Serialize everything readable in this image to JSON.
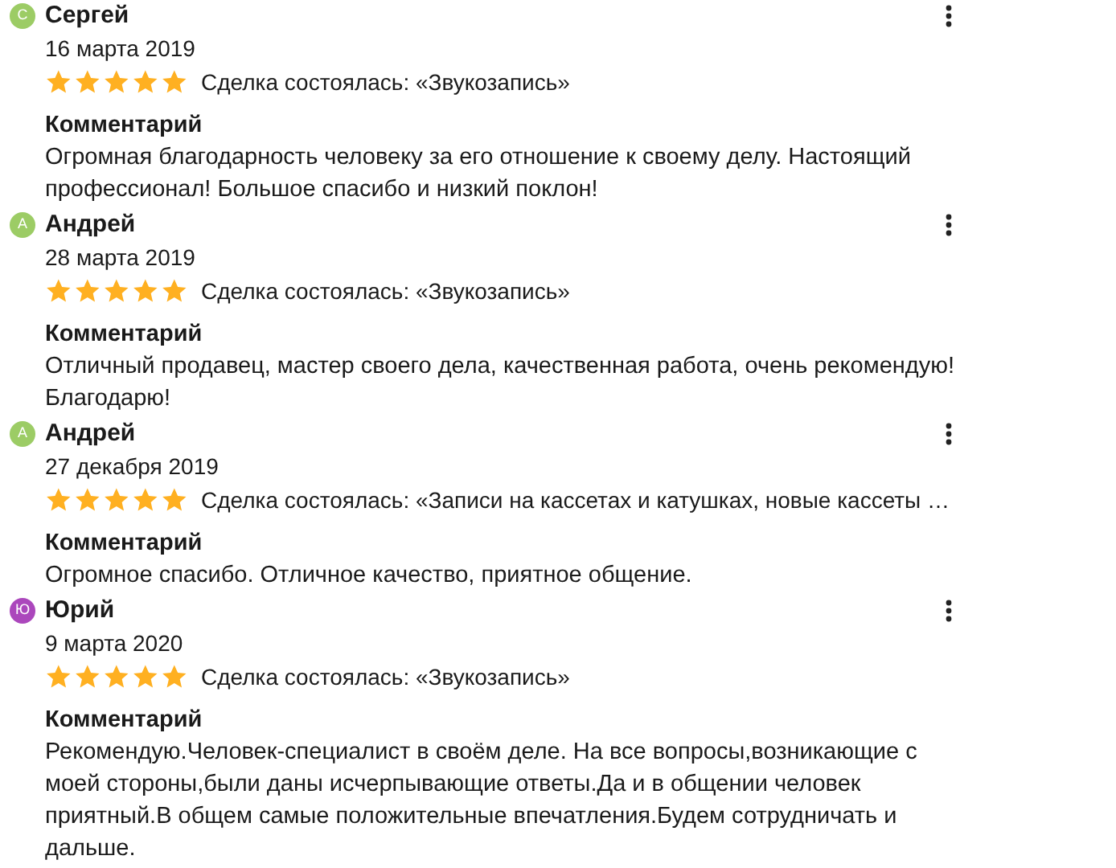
{
  "reviews": [
    {
      "avatar": "С",
      "color": "#9ccc65",
      "name": "Сергей",
      "date": "16 марта 2019",
      "stars": 5,
      "deal": "Сделка состоялась: «Звукозапись»",
      "comment_label": "Комментарий",
      "comment": "Огромная благодарность человеку за его отношение к своему делу. Настоящий профессионал! Большое спасибо и низкий поклон!"
    },
    {
      "avatar": "А",
      "color": "#9ccc65",
      "name": "Андрей",
      "date": "28 марта 2019",
      "stars": 5,
      "deal": "Сделка состоялась: «Звукозапись»",
      "comment_label": "Комментарий",
      "comment": "Отличный продавец, мастер своего дела, качественная работа, очень рекомендую! Благодарю!"
    },
    {
      "avatar": "А",
      "color": "#9ccc65",
      "name": "Андрей",
      "date": "27 декабря 2019",
      "stars": 5,
      "deal": "Сделка состоялась: «Записи на кассетах и катушках, новые кассеты …",
      "comment_label": "Комментарий",
      "comment": "Огромное спасибо. Отличное качество, приятное общение."
    },
    {
      "avatar": "Ю",
      "color": "#ab47bc",
      "name": "Юрий",
      "date": "9 марта 2020",
      "stars": 5,
      "deal": "Сделка состоялась: «Звукозапись»",
      "comment_label": "Комментарий",
      "comment": "Рекомендую.Человек-специалист в своём деле. На все вопросы,возникающие с моей стороны,были даны исчерпывающие ответы.Да и в общении человек приятный.В общем самые положительные впечатления.Будем сотрудничать и дальше."
    }
  ]
}
